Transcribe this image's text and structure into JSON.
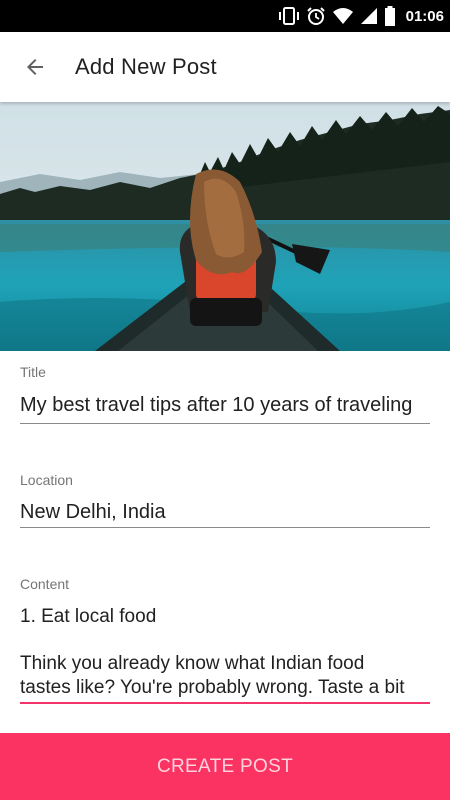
{
  "status_bar": {
    "time": "01:06",
    "icons": [
      "vibrate-icon",
      "alarm-icon",
      "wifi-icon",
      "signal-icon",
      "battery-icon"
    ]
  },
  "app_bar": {
    "back_icon": "arrow-back-icon",
    "title": "Add New Post"
  },
  "hero_image": {
    "description_icon": "photo-girl-in-canoe-on-lake"
  },
  "form": {
    "title": {
      "label": "Title",
      "value": "My best travel tips after 10 years of traveling"
    },
    "location": {
      "label": "Location",
      "value": "New Delhi, India"
    },
    "content": {
      "label": "Content",
      "heading": "1. Eat local food",
      "line1": "Think you already know what Indian food",
      "line2": "tastes like? You're probably wrong. Taste a bit"
    }
  },
  "action": {
    "create_label": "CREATE POST"
  },
  "colors": {
    "accent": "#fa3362",
    "status_bar": "#000000",
    "background": "#ffffff"
  }
}
